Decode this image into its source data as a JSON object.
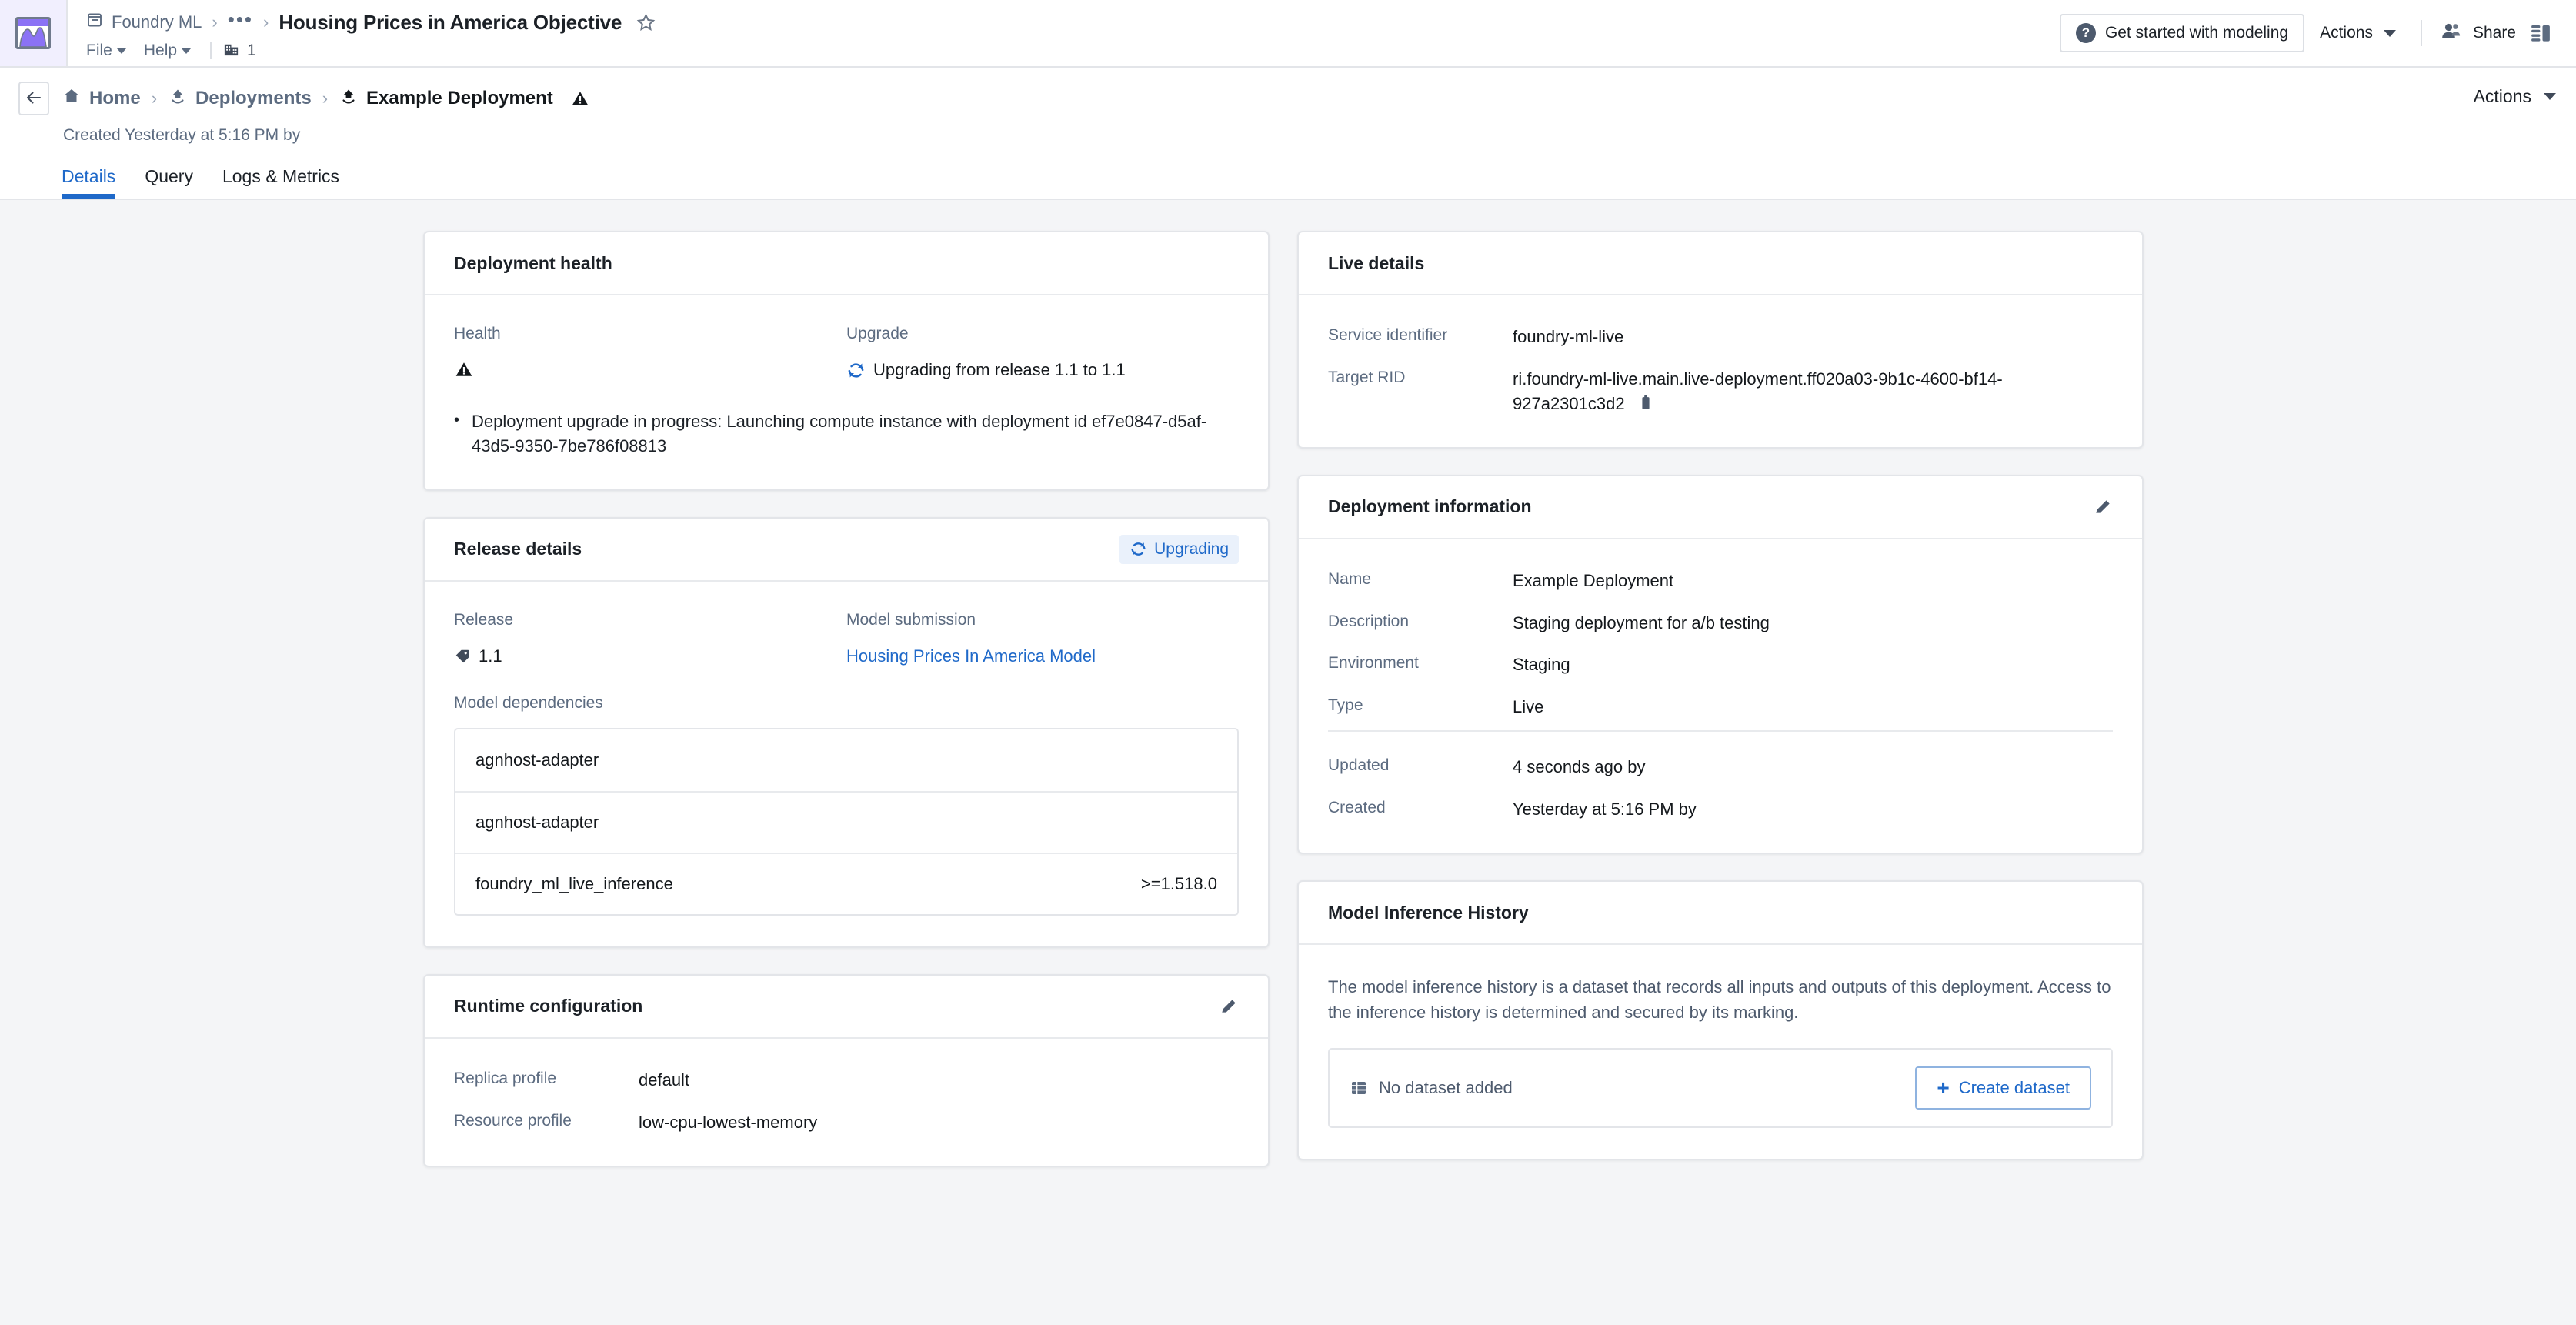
{
  "app": {
    "logo_icon": "chart-app-logo-icon",
    "breadcrumb_app": "Foundry ML",
    "breadcrumb_dots": "•••",
    "breadcrumb_sep": "›",
    "page_title": "Housing Prices in America Objective",
    "star_icon": "star-outline-icon",
    "menus": [
      {
        "label": "File"
      },
      {
        "label": "Help"
      }
    ],
    "org_icon": "building-icon",
    "org_count": "1",
    "get_started_label": "Get started with modeling",
    "get_started_icon": "help-circle-icon",
    "actions_label": "Actions",
    "share_label": "Share",
    "share_icon": "people-icon",
    "panel_toggle_icon": "side-panel-icon"
  },
  "subheader": {
    "back_icon": "arrow-left-icon",
    "breadcrumbs": [
      {
        "label": "Home",
        "icon": "home-icon",
        "current": false
      },
      {
        "label": "Deployments",
        "icon": "deployment-icon",
        "current": false
      },
      {
        "label": "Example Deployment",
        "icon": "deployment-icon",
        "current": true
      }
    ],
    "warning_icon": "warning-triangle-icon",
    "created_line": "Created Yesterday at 5:16 PM by",
    "tabs": [
      {
        "label": "Details",
        "active": true
      },
      {
        "label": "Query",
        "active": false
      },
      {
        "label": "Logs & Metrics",
        "active": false
      }
    ],
    "actions_label": "Actions"
  },
  "deployment_health": {
    "title": "Deployment health",
    "health_label": "Health",
    "health_icon": "warning-triangle-icon",
    "upgrade_label": "Upgrade",
    "upgrade_status": "Upgrading from release 1.1 to 1.1",
    "upgrade_icon": "refresh-icon",
    "bullet": "Deployment upgrade in progress: Launching compute instance with deployment id ef7e0847-d5af-43d5-9350-7be786f08813"
  },
  "release_details": {
    "title": "Release details",
    "badge_label": "Upgrading",
    "badge_icon": "refresh-icon",
    "release_label": "Release",
    "release_value": "1.1",
    "release_icon": "tag-icon",
    "submission_label": "Model submission",
    "submission_value": "Housing Prices In America Model",
    "dependencies_label": "Model dependencies",
    "dependencies": [
      {
        "name": "agnhost-adapter",
        "version": ""
      },
      {
        "name": "agnhost-adapter",
        "version": ""
      },
      {
        "name": "foundry_ml_live_inference",
        "version": ">=1.518.0"
      }
    ]
  },
  "runtime_configuration": {
    "title": "Runtime configuration",
    "edit_icon": "pencil-icon",
    "rows": [
      {
        "key": "Replica profile",
        "value": "default"
      },
      {
        "key": "Resource profile",
        "value": "low-cpu-lowest-memory"
      }
    ]
  },
  "live_details": {
    "title": "Live details",
    "rows": [
      {
        "key": "Service identifier",
        "value": "foundry-ml-live"
      },
      {
        "key": "Target RID",
        "value": "ri.foundry-ml-live.main.live-deployment.ff020a03-9b1c-4600-bf14-927a2301c3d2"
      }
    ],
    "copy_icon": "copy-clipboard-icon"
  },
  "deployment_information": {
    "title": "Deployment information",
    "edit_icon": "pencil-icon",
    "rows": [
      {
        "key": "Name",
        "value": "Example Deployment"
      },
      {
        "key": "Description",
        "value": "Staging deployment for a/b testing"
      },
      {
        "key": "Environment",
        "value": "Staging"
      },
      {
        "key": "Type",
        "value": "Live"
      }
    ],
    "meta_rows": [
      {
        "key": "Updated",
        "value": "4 seconds ago by"
      },
      {
        "key": "Created",
        "value": "Yesterday at 5:16 PM by"
      }
    ]
  },
  "model_inference_history": {
    "title": "Model Inference History",
    "description": "The model inference history is a dataset that records all inputs and outputs of this deployment. Access to the inference history is determined and secured by its marking.",
    "empty_label": "No dataset added",
    "empty_icon": "table-icon",
    "create_label": "Create dataset",
    "create_icon": "plus-icon"
  },
  "colors": {
    "accent_blue": "#1f69c9",
    "page_bg": "#f4f5f7",
    "card_bg": "#ffffff",
    "border": "#e3e5e9",
    "muted_text": "#5c6b80",
    "logo_purple": "#8b72f5"
  }
}
